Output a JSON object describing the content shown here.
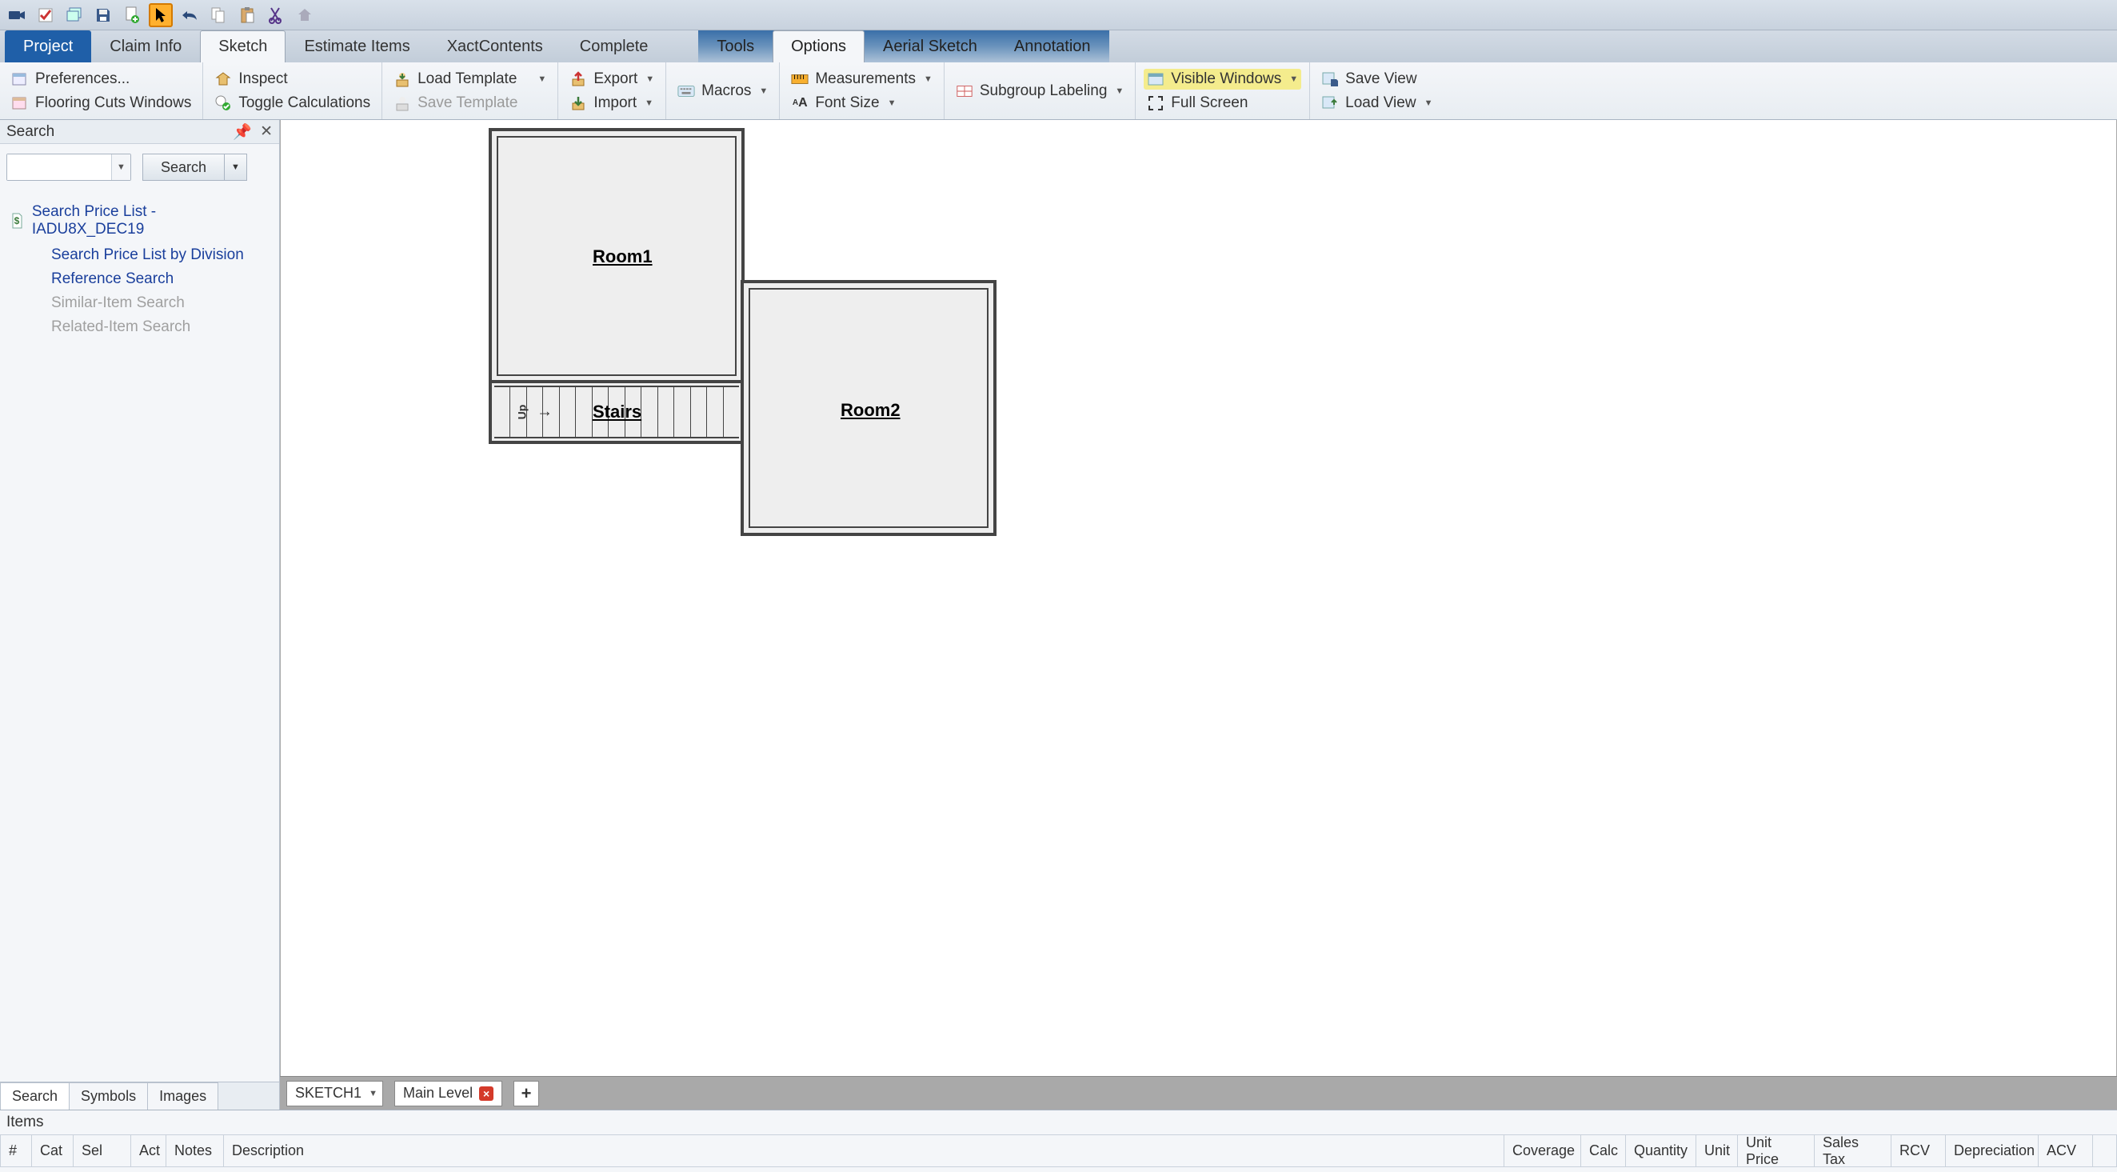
{
  "qat_icons": [
    "camera",
    "checklist",
    "windows",
    "save",
    "doc-plus",
    "pointer",
    "undo",
    "copy",
    "paste",
    "cut",
    "home"
  ],
  "tabs_left": [
    {
      "label": "Project",
      "primary": true
    },
    {
      "label": "Claim Info"
    },
    {
      "label": "Sketch",
      "active": true
    },
    {
      "label": "Estimate Items"
    },
    {
      "label": "XactContents"
    },
    {
      "label": "Complete"
    }
  ],
  "tabs_right": [
    {
      "label": "Tools"
    },
    {
      "label": "Options",
      "active": true
    },
    {
      "label": "Aerial Sketch"
    },
    {
      "label": "Annotation"
    }
  ],
  "ribbon": {
    "preferences": "Preferences...",
    "flooring": "Flooring Cuts Windows",
    "inspect": "Inspect",
    "toggle": "Toggle Calculations",
    "loadTemplate": "Load Template",
    "saveTemplate": "Save Template",
    "export": "Export",
    "import": "Import",
    "macros": "Macros",
    "measurements": "Measurements",
    "fontSize": "Font Size",
    "subgroup": "Subgroup Labeling",
    "visibleWindows": "Visible Windows",
    "fullScreen": "Full Screen",
    "saveView": "Save View",
    "loadView": "Load View"
  },
  "sidebar": {
    "title": "Search",
    "searchBtn": "Search",
    "tree": {
      "root": "Search Price List - IADU8X_DEC19",
      "items": [
        {
          "label": "Search Price List by Division",
          "enabled": true
        },
        {
          "label": "Reference Search",
          "enabled": true
        },
        {
          "label": "Similar-Item Search",
          "enabled": false
        },
        {
          "label": "Related-Item Search",
          "enabled": false
        }
      ]
    },
    "bottomTabs": [
      "Search",
      "Symbols",
      "Images"
    ]
  },
  "sketch": {
    "selector": "SKETCH1",
    "level": "Main Level",
    "rooms": {
      "r1": "Room1",
      "r2": "Room2",
      "stairs": "Stairs",
      "up": "Up"
    }
  },
  "items": {
    "title": "Items",
    "cols": [
      "#",
      "Cat",
      "Sel",
      "Act",
      "Notes",
      "Description",
      "Coverage",
      "Calc",
      "Quantity",
      "Unit",
      "Unit Price",
      "Sales Tax",
      "RCV",
      "Depreciation",
      "ACV"
    ]
  }
}
